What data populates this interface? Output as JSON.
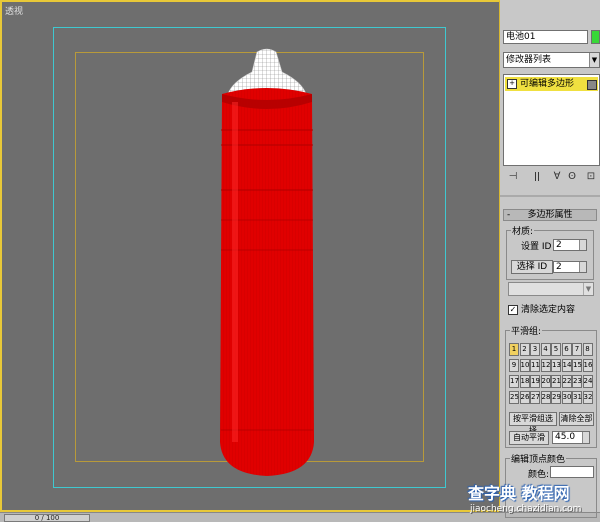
{
  "viewport": {
    "label": "透视"
  },
  "timeline": {
    "frame_readout": "0 / 100"
  },
  "panel": {
    "object_name": "电池01",
    "object_color": "#38d838",
    "modifier_list_label": "修改器列表",
    "stack_item": "可编辑多边形",
    "rollout_title": "多边形属性",
    "material": {
      "group_title": "材质:",
      "set_id_label": "设置 ID",
      "set_id_value": "2",
      "select_id_button": "选择 ID",
      "select_id_value": "2"
    },
    "clear_selection_label": "清除选定内容",
    "clear_selection_checked": true,
    "smoothing": {
      "group_title": "平滑组:",
      "buttons": [
        "1",
        "2",
        "3",
        "4",
        "5",
        "6",
        "7",
        "8",
        "9",
        "10",
        "11",
        "12",
        "13",
        "14",
        "15",
        "16",
        "17",
        "18",
        "19",
        "20",
        "21",
        "22",
        "23",
        "24",
        "25",
        "26",
        "27",
        "28",
        "29",
        "30",
        "31",
        "32"
      ],
      "active_button": "1",
      "select_by_sg_button": "按平滑组选择",
      "clear_all_button": "清除全部",
      "auto_smooth_button": "自动平滑",
      "auto_smooth_value": "45.0"
    },
    "vertex_colors": {
      "group_title": "编辑顶点颜色",
      "color_label": "颜色:"
    }
  },
  "watermark": {
    "main": "查字典 教程网",
    "sub": "jiaocheng.chazidian.com"
  },
  "colors": {
    "battery_body": "#e00000",
    "battery_cap_wire": "#ffffff",
    "viewport_bg": "#6e6e6e",
    "active_border": "#e8c838",
    "safe_frame": "#3fc8d0",
    "stack_highlight": "#f0e040"
  }
}
